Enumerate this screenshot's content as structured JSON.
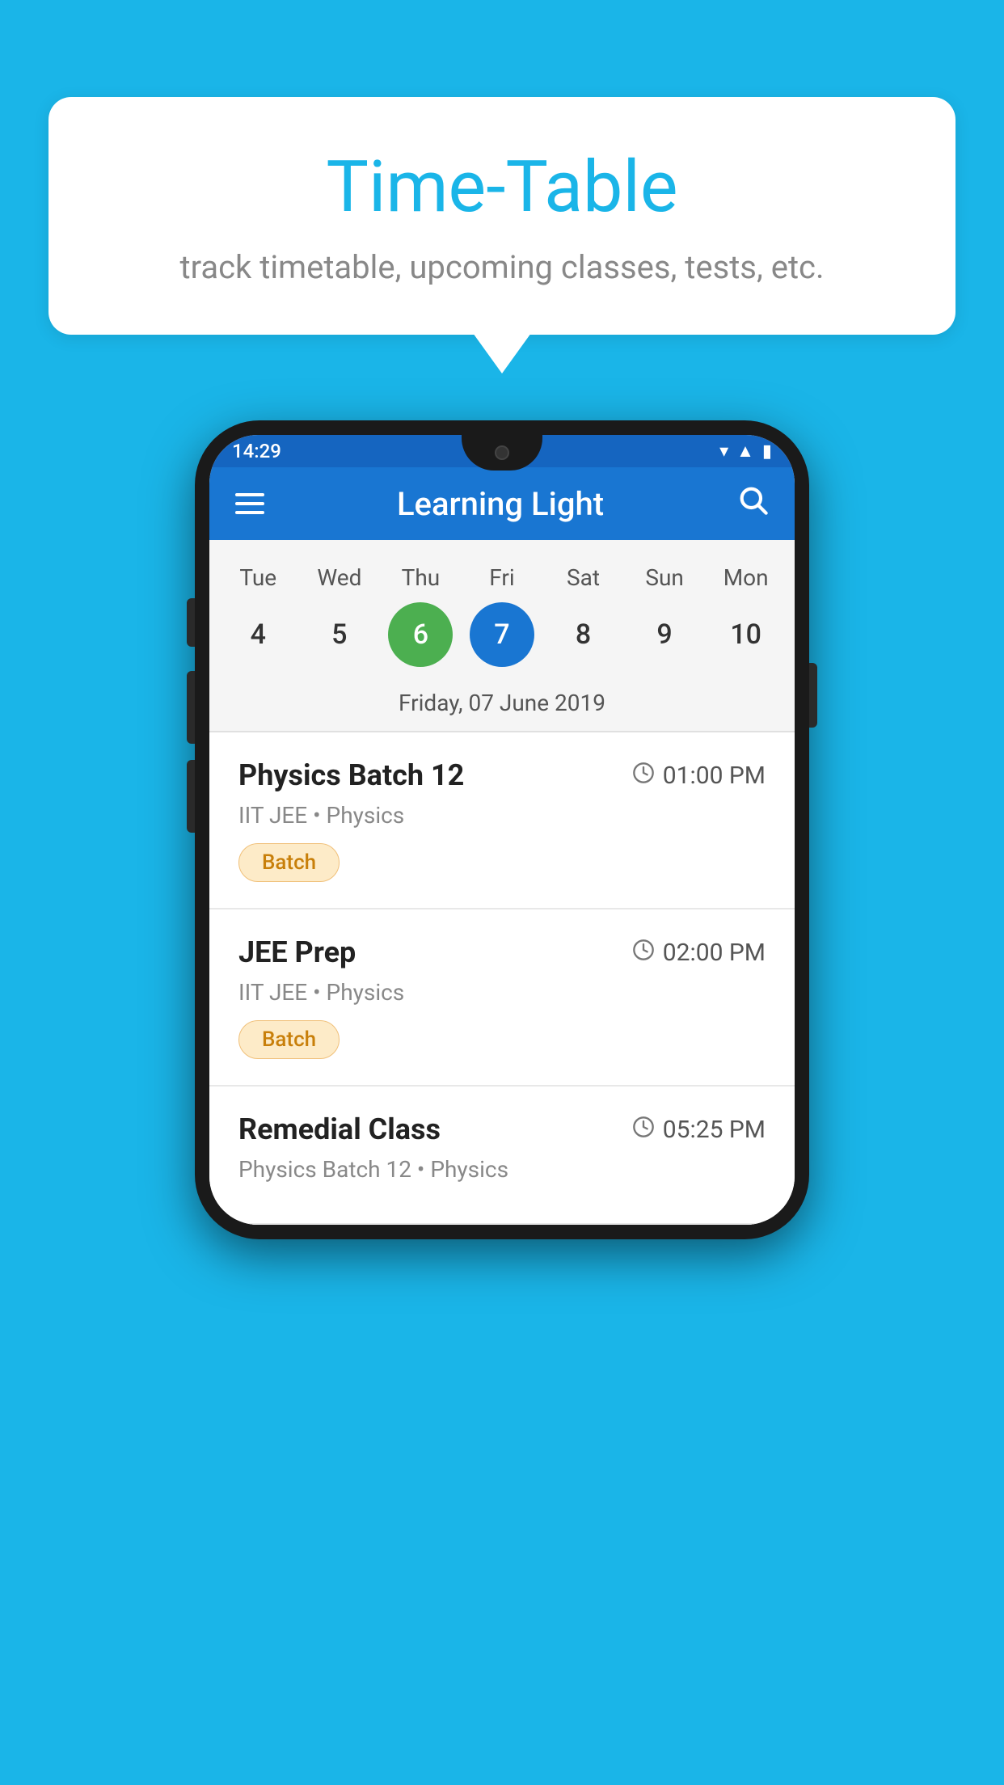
{
  "background_color": "#1ab5e8",
  "speech_bubble": {
    "title": "Time-Table",
    "subtitle": "track timetable, upcoming classes, tests, etc."
  },
  "app": {
    "name": "Learning Light",
    "header_title": "Learning Light"
  },
  "status_bar": {
    "time": "14:29",
    "wifi": "▼",
    "signal": "▲",
    "battery": "▮"
  },
  "calendar": {
    "selected_date_label": "Friday, 07 June 2019",
    "days": [
      {
        "name": "Tue",
        "date": "4",
        "state": "normal"
      },
      {
        "name": "Wed",
        "date": "5",
        "state": "normal"
      },
      {
        "name": "Thu",
        "date": "6",
        "state": "today"
      },
      {
        "name": "Fri",
        "date": "7",
        "state": "selected"
      },
      {
        "name": "Sat",
        "date": "8",
        "state": "normal"
      },
      {
        "name": "Sun",
        "date": "9",
        "state": "normal"
      },
      {
        "name": "Mon",
        "date": "10",
        "state": "normal"
      }
    ]
  },
  "schedule": {
    "items": [
      {
        "title": "Physics Batch 12",
        "time": "01:00 PM",
        "meta": "IIT JEE • Physics",
        "tag": "Batch"
      },
      {
        "title": "JEE Prep",
        "time": "02:00 PM",
        "meta": "IIT JEE • Physics",
        "tag": "Batch"
      },
      {
        "title": "Remedial Class",
        "time": "05:25 PM",
        "meta": "Physics Batch 12 • Physics",
        "tag": ""
      }
    ]
  }
}
